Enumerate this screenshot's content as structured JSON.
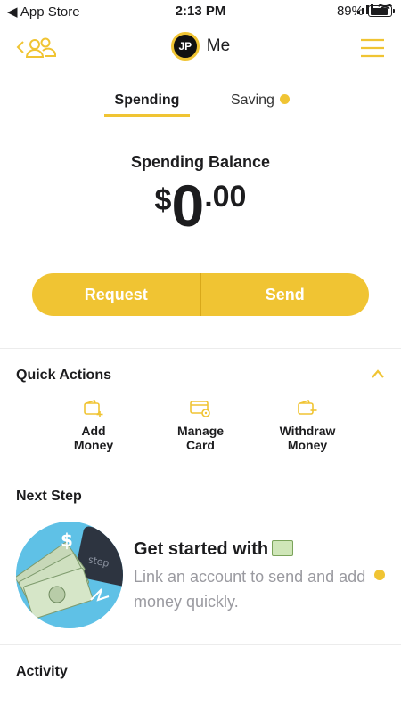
{
  "status_bar": {
    "back_label": "◀ App Store",
    "time": "2:13 PM",
    "battery": "89%",
    "battery_level": 0.89
  },
  "header": {
    "avatar_initials": "JP",
    "title": "Me"
  },
  "tabs": [
    {
      "label": "Spending",
      "active": true
    },
    {
      "label": "Saving",
      "active": false,
      "has_dot": true
    }
  ],
  "balance": {
    "label": "Spending Balance",
    "currency": "$",
    "whole": "0",
    "cents": ".00"
  },
  "actions": {
    "request_label": "Request",
    "send_label": "Send"
  },
  "quick_actions": {
    "title": "Quick Actions",
    "items": [
      {
        "line1": "Add",
        "line2": "Money",
        "icon": "wallet-add-icon"
      },
      {
        "line1": "Manage",
        "line2": "Card",
        "icon": "card-settings-icon"
      },
      {
        "line1": "Withdraw",
        "line2": "Money",
        "icon": "wallet-withdraw-icon"
      }
    ]
  },
  "next_step": {
    "title": "Next Step",
    "card_title": "Get started with",
    "card_emoji": "money-emoji",
    "card_description": "Link an account to send and add money quickly."
  },
  "activity": {
    "title": "Activity"
  },
  "colors": {
    "accent": "#f0c433",
    "text": "#1c1c1e",
    "muted": "#9a9aa0"
  }
}
